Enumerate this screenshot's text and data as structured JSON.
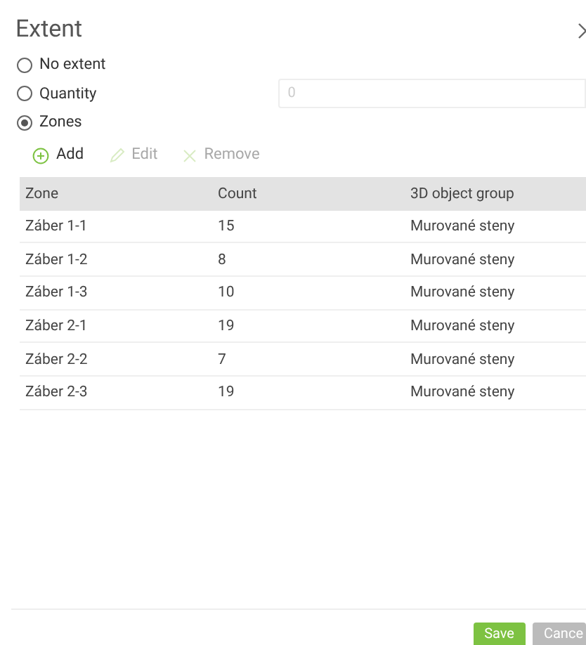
{
  "dialog": {
    "title": "Extent"
  },
  "options": [
    {
      "label": "No extent",
      "selected": false
    },
    {
      "label": "Quantity",
      "selected": false,
      "input_value": "0"
    },
    {
      "label": "Zones",
      "selected": true
    }
  ],
  "toolbar": [
    {
      "kind": "add",
      "label": "Add",
      "disabled": false
    },
    {
      "kind": "edit",
      "label": "Edit",
      "disabled": true
    },
    {
      "kind": "remove",
      "label": "Remove",
      "disabled": true
    }
  ],
  "table": {
    "columns": [
      "Zone",
      "Count",
      "3D object group"
    ],
    "rows": [
      [
        "Záber 1-1",
        "15",
        "Murované steny"
      ],
      [
        "Záber 1-2",
        "8",
        "Murované steny"
      ],
      [
        "Záber 1-3",
        "10",
        "Murované steny"
      ],
      [
        "Záber 2-1",
        "19",
        "Murované steny"
      ],
      [
        "Záber 2-2",
        "7",
        "Murované steny"
      ],
      [
        "Záber 2-3",
        "19",
        "Murované steny"
      ]
    ]
  },
  "buttons": [
    {
      "kind": "primary",
      "label": "Save"
    },
    {
      "kind": "secondary",
      "label": "Cance"
    }
  ]
}
